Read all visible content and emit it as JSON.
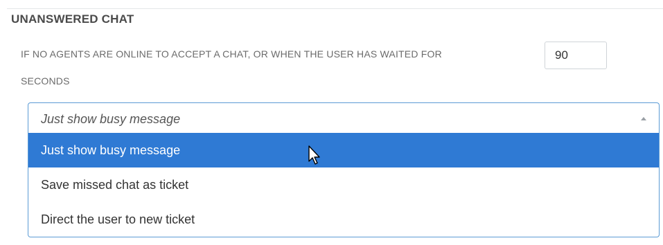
{
  "section": {
    "title": "UNANSWERED CHAT",
    "description_line1": "IF NO AGENTS ARE ONLINE TO ACCEPT A CHAT, OR WHEN THE USER HAS WAITED FOR",
    "description_line2": "SECONDS"
  },
  "wait_seconds": {
    "value": "90"
  },
  "action_select": {
    "selected": "Just show busy message",
    "options": [
      {
        "label": "Just show busy message",
        "highlighted": true
      },
      {
        "label": "Save missed chat as ticket",
        "highlighted": false
      },
      {
        "label": "Direct the user to new ticket",
        "highlighted": false
      }
    ]
  },
  "colors": {
    "highlight": "#2f7ad4",
    "focus_border": "#5b9bd5",
    "title_text": "#4a4a4a",
    "label_text": "#6b6b6b"
  },
  "icons": {
    "caret": "caret-up-icon",
    "pointer": "mouse-pointer-icon"
  }
}
